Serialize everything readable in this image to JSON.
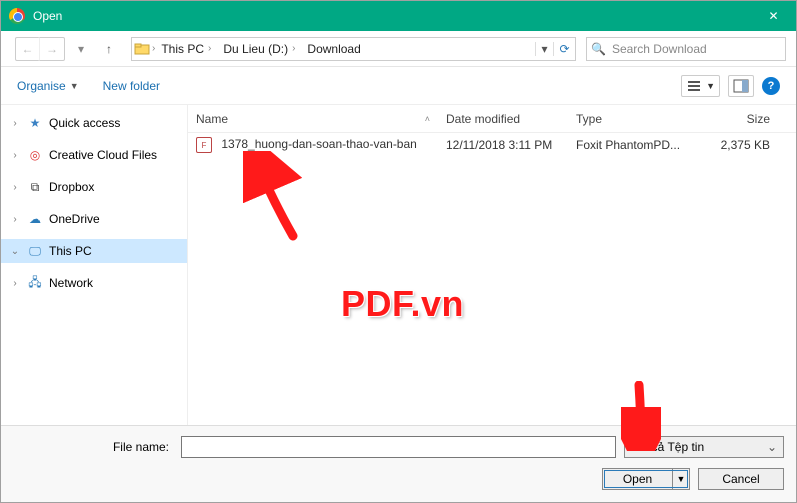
{
  "window": {
    "title": "Open",
    "close_glyph": "✕"
  },
  "nav": {
    "crumbs": [
      "This PC",
      "Du Lieu (D:)",
      "Download"
    ],
    "search_placeholder": "Search Download"
  },
  "toolbar": {
    "organise": "Organise",
    "newfolder": "New folder"
  },
  "sidebar": {
    "items": [
      {
        "label": "Quick access",
        "iconColor": "#3b82c4",
        "glyph": "★"
      },
      {
        "label": "Creative Cloud Files",
        "iconColor": "#d33",
        "glyph": "◎"
      },
      {
        "label": "Dropbox",
        "iconColor": "#333",
        "glyph": "⧉"
      },
      {
        "label": "OneDrive",
        "iconColor": "#2a7ab8",
        "glyph": "☁"
      },
      {
        "label": "This PC",
        "iconColor": "#2a7ab8",
        "glyph": "🖵",
        "selected": true,
        "expanded": true
      },
      {
        "label": "Network",
        "iconColor": "#2a7ab8",
        "glyph": "🖧"
      }
    ]
  },
  "columns": {
    "name": "Name",
    "date": "Date modified",
    "type": "Type",
    "size": "Size"
  },
  "files": [
    {
      "name": "1378_huong-dan-soan-thao-van-ban",
      "date": "12/11/2018 3:11 PM",
      "type": "Foxit PhantomPD...",
      "size": "2,375 KB"
    }
  ],
  "footer": {
    "filename_label": "File name:",
    "filename_value": "",
    "filter": "Tất cả Tệp tin",
    "open": "Open",
    "cancel": "Cancel"
  },
  "watermark": "PDF.vn"
}
